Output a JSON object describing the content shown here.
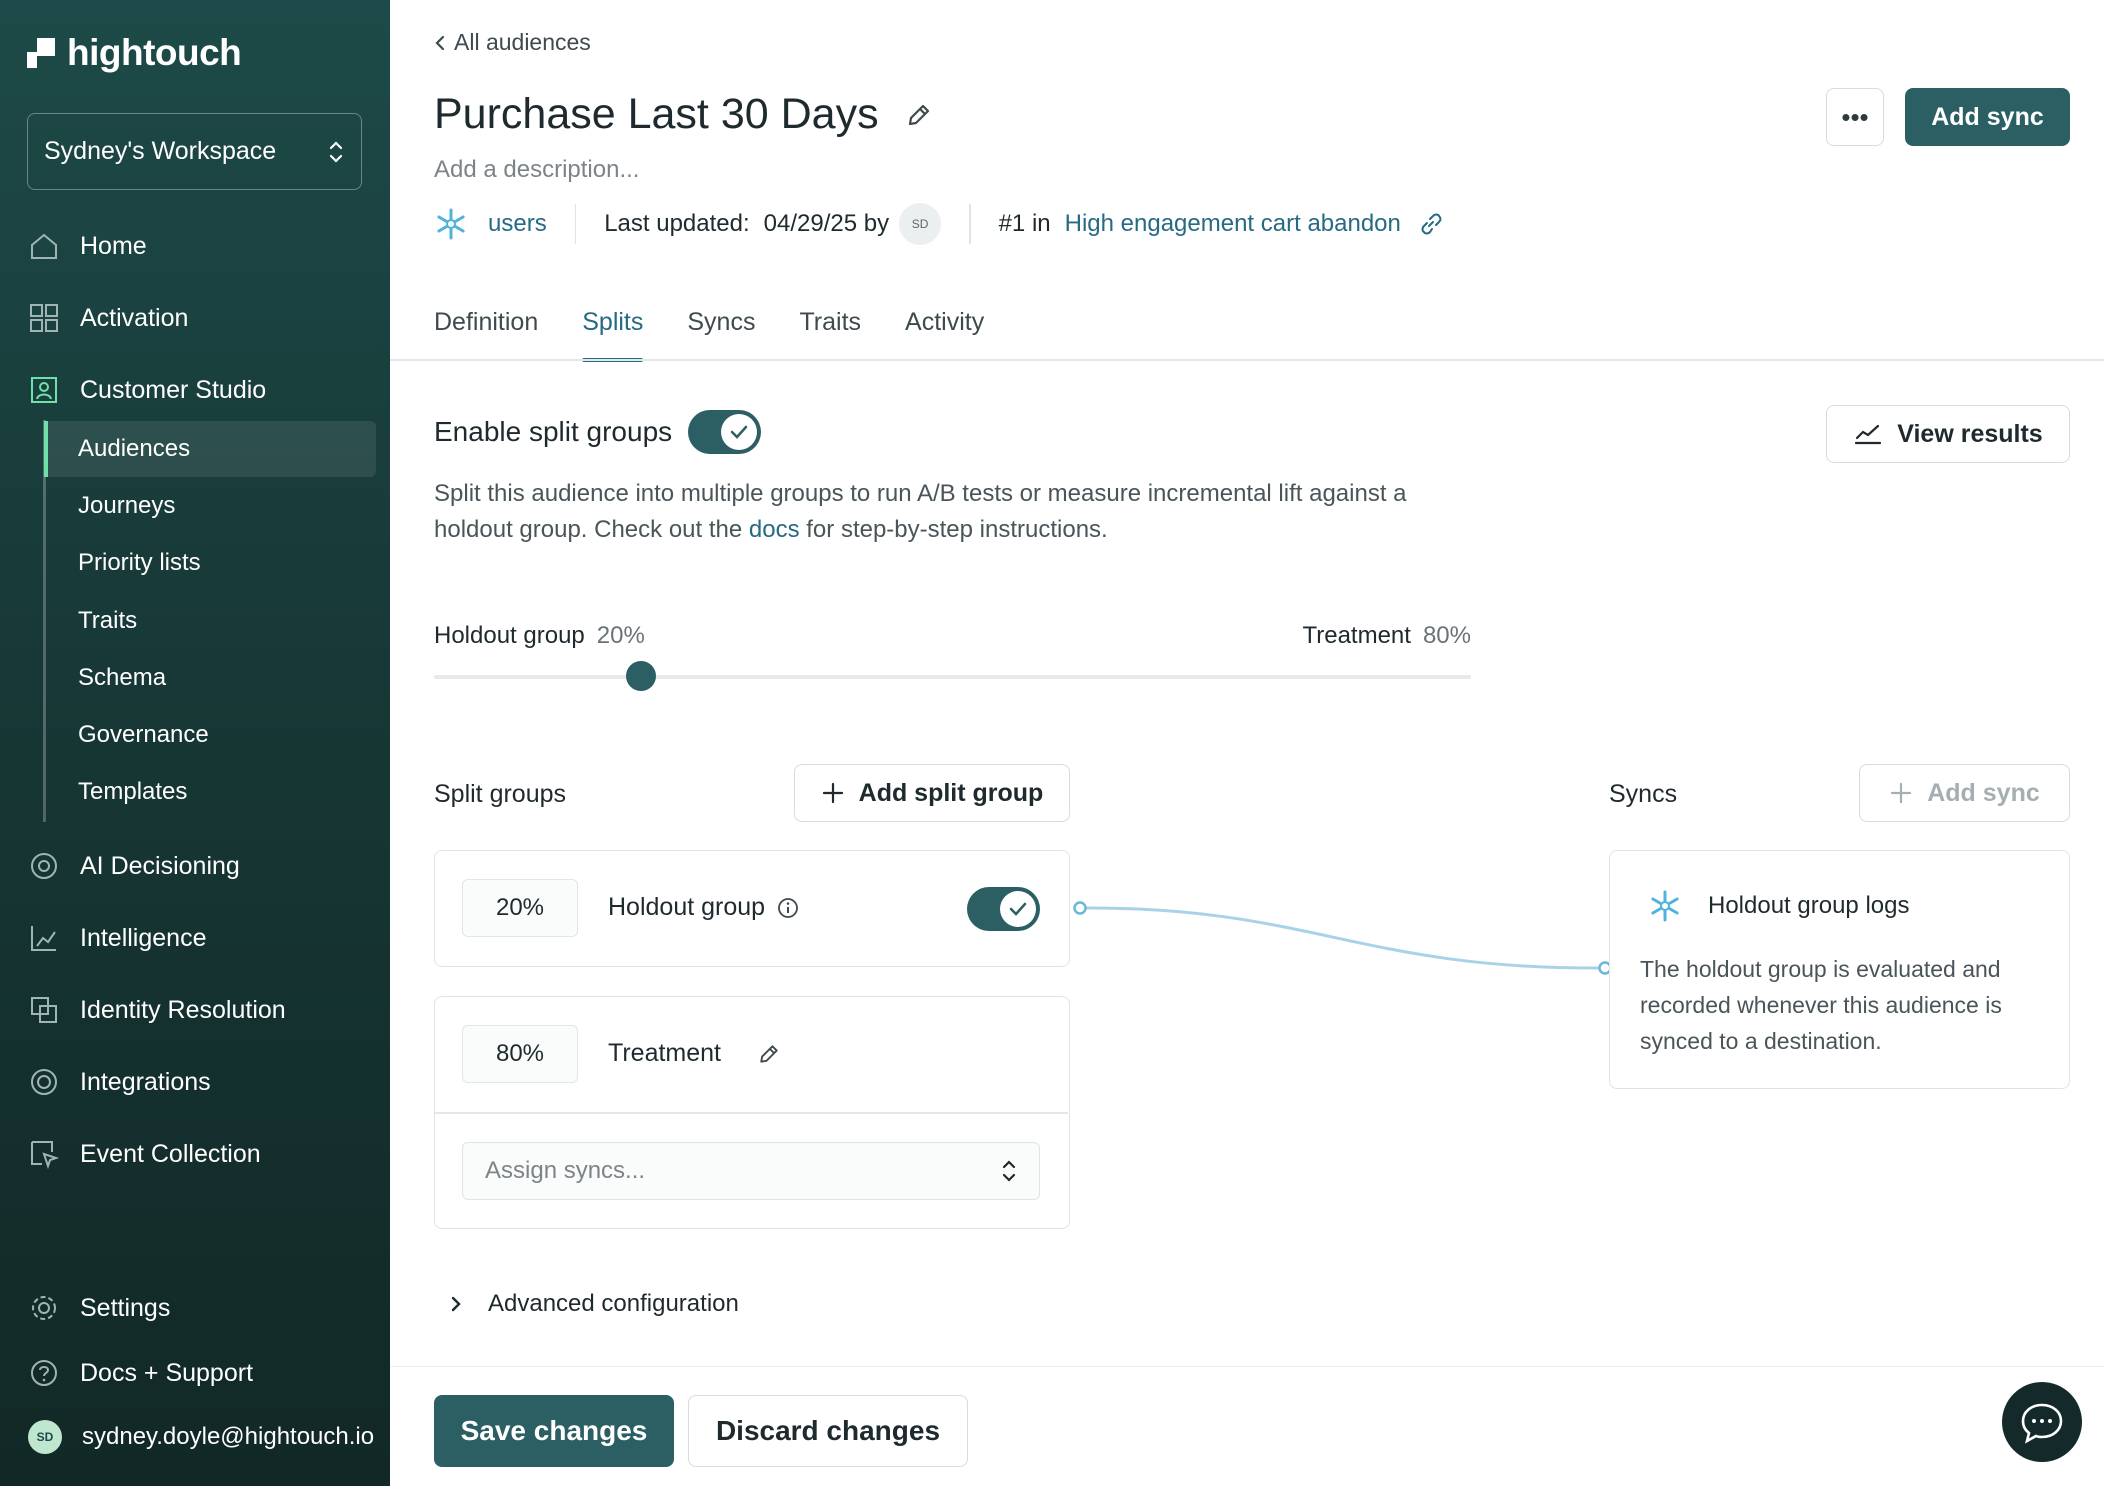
{
  "app": {
    "logo_text": "hightouch"
  },
  "sidebar": {
    "workspace": "Sydney's Workspace",
    "items": [
      {
        "label": "Home",
        "icon": "home-icon"
      },
      {
        "label": "Activation",
        "icon": "activation-icon"
      },
      {
        "label": "Customer Studio",
        "icon": "customer-studio-icon"
      },
      {
        "label": "AI Decisioning",
        "icon": "ai-decisioning-icon"
      },
      {
        "label": "Intelligence",
        "icon": "intelligence-icon"
      },
      {
        "label": "Identity Resolution",
        "icon": "identity-resolution-icon"
      },
      {
        "label": "Integrations",
        "icon": "integrations-icon"
      },
      {
        "label": "Event Collection",
        "icon": "event-collection-icon"
      }
    ],
    "sub_items": [
      "Audiences",
      "Journeys",
      "Priority lists",
      "Traits",
      "Schema",
      "Governance",
      "Templates"
    ],
    "active_sub_item": "Audiences",
    "settings": "Settings",
    "docs": "Docs + Support",
    "user_email": "sydney.doyle@hightouch.io",
    "user_initials": "SD"
  },
  "header": {
    "back": "All audiences",
    "title": "Purchase Last 30 Days",
    "description_placeholder": "Add a description...",
    "source": "users",
    "last_updated_label": "Last updated:",
    "last_updated_value": "04/29/25 by",
    "updated_by_initials": "SD",
    "rank_label": "#1 in",
    "rank_link": "High engagement cart abandon",
    "add_sync": "Add sync",
    "more": "•••"
  },
  "tabs": [
    "Definition",
    "Splits",
    "Syncs",
    "Traits",
    "Activity"
  ],
  "active_tab": "Splits",
  "splits": {
    "enable_label": "Enable split groups",
    "enabled": true,
    "view_results": "View results",
    "intro_before": "Split this audience into multiple groups to run A/B tests or measure incremental lift against a holdout group. Check out the ",
    "intro_link": "docs",
    "intro_after": " for step-by-step instructions.",
    "holdout_label": "Holdout group",
    "holdout_pct": "20%",
    "treatment_label": "Treatment",
    "treatment_pct": "80%",
    "slider_fraction": 0.2,
    "split_groups_label": "Split groups",
    "add_split_group": "Add split group",
    "syncs_label": "Syncs",
    "add_sync": "Add sync",
    "groups": [
      {
        "pct": "20%",
        "name": "Holdout group",
        "enabled": true
      },
      {
        "pct": "80%",
        "name": "Treatment",
        "assign_placeholder": "Assign syncs..."
      }
    ],
    "sync_card": {
      "title": "Holdout group logs",
      "text": "The holdout group is evaluated and recorded whenever this audience is synced to a destination."
    },
    "advanced": "Advanced configuration"
  },
  "footer": {
    "save": "Save changes",
    "discard": "Discard changes"
  },
  "colors": {
    "primary": "#2b5f64",
    "link": "#266a84",
    "sidebar": "#173836",
    "connector": "#a8d3e6"
  }
}
